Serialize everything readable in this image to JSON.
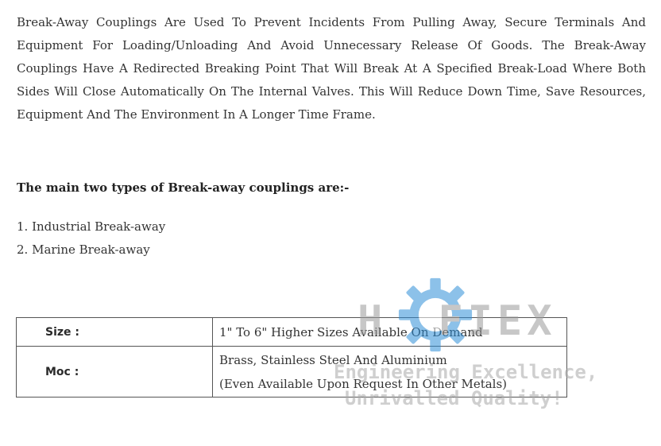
{
  "intro": {
    "paragraph": "Break-away Couplings Are Used To Prevent Incidents From Pulling Away, Secure Terminals And Equipment For Loading/unloading And Avoid Unnecessary Release Of Goods. The Break-away Couplings Have A Redirected Breaking Point That Will Break At A Specified Break-load Where Both Sides Will Close Automatically On The Internal Valves. This Will Reduce Down Time, Save Resources, Equipment And The Environment In A Longer Time Frame."
  },
  "types": {
    "heading": "The main two types of Break-away couplings are:-",
    "items": [
      "1. Industrial Break-away",
      "2. Marine Break-away"
    ]
  },
  "specs": {
    "rows": [
      {
        "label": "Size :",
        "values": [
          "1\" To 6\" Higher Sizes Available On Demand"
        ]
      },
      {
        "label": "Moc :",
        "values": [
          "Brass, Stainless Steel And Aluminium",
          "(Even Available Upon Request In Other Metals)"
        ]
      }
    ]
  },
  "watermark": {
    "brand_left": "H",
    "brand_right": "FIEX",
    "tagline_1": "Engineering Excellence,",
    "tagline_2": "Unrivalled Quality!",
    "gear_color": "#2f8fd8",
    "text_color": "#9a9a9a"
  }
}
